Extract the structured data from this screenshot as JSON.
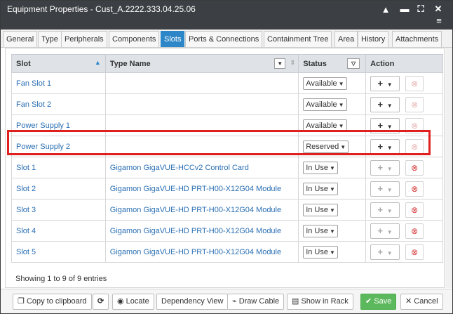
{
  "window": {
    "title": "Equipment Properties - Cust_A.2222.333.04.25.06",
    "controls": {
      "collapse": "▲",
      "minimize": "▬",
      "maximize": "⛶",
      "close": "✕",
      "menu": "≡"
    }
  },
  "tabs": [
    "General",
    "Type",
    "Peripherals",
    "Components",
    "Slots",
    "Ports & Connections",
    "Containment Tree",
    "Area",
    "History",
    "Attachments"
  ],
  "active_tab": "Slots",
  "table": {
    "headers": {
      "slot": "Slot",
      "type_name": "Type Name",
      "status": "Status",
      "action": "Action"
    },
    "rows": [
      {
        "slot": "Fan Slot 1",
        "type_name": "",
        "status": "Available"
      },
      {
        "slot": "Fan Slot 2",
        "type_name": "",
        "status": "Available"
      },
      {
        "slot": "Power Supply 1",
        "type_name": "",
        "status": "Available"
      },
      {
        "slot": "Power Supply 2",
        "type_name": "",
        "status": "Reserved"
      },
      {
        "slot": "Slot 1",
        "type_name": "Gigamon GigaVUE-HCCv2 Control Card",
        "status": "In Use"
      },
      {
        "slot": "Slot 2",
        "type_name": "Gigamon GigaVUE-HD PRT-H00-X12G04 Module",
        "status": "In Use"
      },
      {
        "slot": "Slot 3",
        "type_name": "Gigamon GigaVUE-HD PRT-H00-X12G04 Module",
        "status": "In Use"
      },
      {
        "slot": "Slot 4",
        "type_name": "Gigamon GigaVUE-HD PRT-H00-X12G04 Module",
        "status": "In Use"
      },
      {
        "slot": "Slot 5",
        "type_name": "Gigamon GigaVUE-HD PRT-H00-X12G04 Module",
        "status": "In Use"
      }
    ]
  },
  "footer": {
    "summary": "Showing 1 to 9 of 9 entries"
  },
  "buttons": {
    "copy": "Copy to clipboard",
    "refresh": "⟳",
    "locate": "Locate",
    "dependency": "Dependency View",
    "draw_cable": "Draw Cable",
    "show_in_rack": "Show in Rack",
    "save": "Save",
    "cancel": "Cancel"
  },
  "icons": {
    "plus": "+",
    "caret": "▼",
    "remove": "⊗",
    "sort_up": "▲",
    "filter": "▽",
    "copy_icon": "❐",
    "locate_icon": "◉",
    "draw_icon": "⌁",
    "rack_icon": "▤",
    "save_icon": "✔",
    "cancel_icon": "✕"
  },
  "colors": {
    "accent": "#2d86c7",
    "highlight": "#e0201e",
    "save": "#5cb85c"
  }
}
